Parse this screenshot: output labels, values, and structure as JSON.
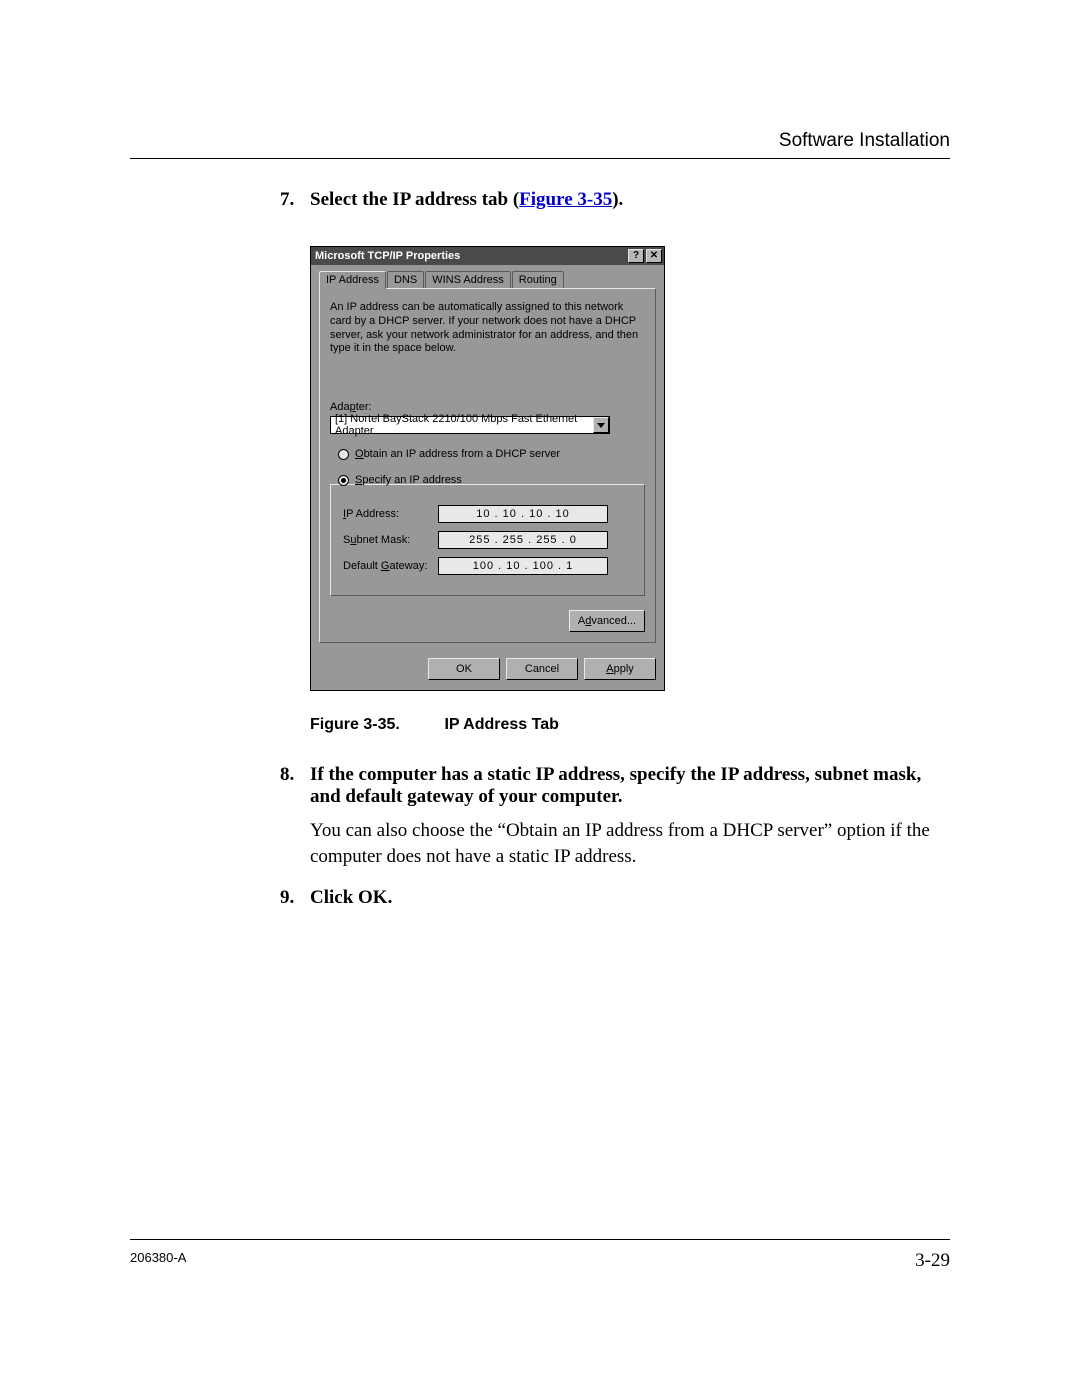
{
  "header": {
    "title": "Software Installation"
  },
  "steps": {
    "s7": {
      "num": "7.",
      "prefix": "Select the IP address tab (",
      "link": "Figure 3-35",
      "suffix": ")."
    },
    "s8": {
      "num": "8.",
      "bold": "If the computer has a static IP address, specify the IP address, subnet mask, and default gateway of your computer.",
      "body": "You can also choose the “Obtain an IP address from a DHCP server” option if the computer does not have a static IP address."
    },
    "s9": {
      "num": "9.",
      "bold": "Click OK."
    }
  },
  "figure": {
    "label": "Figure 3-35.",
    "caption": "IP Address Tab"
  },
  "dialog": {
    "title": "Microsoft TCP/IP Properties",
    "help": "?",
    "close": "✕",
    "tabs": {
      "ip": "IP Address",
      "dns": "DNS",
      "wins": "WINS Address",
      "routing": "Routing"
    },
    "desc": "An IP address can be automatically assigned to this network card by a DHCP server. If your network does not have a DHCP server, ask your network administrator for an address, and then type it in the space below.",
    "adapter_label_pre": "Ada",
    "adapter_label_u": "p",
    "adapter_label_post": "ter:",
    "adapter_value": "[1] Nortel BayStack 2210/100 Mbps Fast Ethernet Adapter",
    "radio_obtain_u": "O",
    "radio_obtain_post": "btain an IP address from a DHCP server",
    "radio_specify_u": "S",
    "radio_specify_post": "pecify an IP address",
    "ip_label_u": "I",
    "ip_label_post": "P Address:",
    "ip_value": "10 . 10 . 10 . 10",
    "subnet_label_pre": "S",
    "subnet_label_u": "u",
    "subnet_label_post": "bnet Mask:",
    "subnet_value": "255 . 255 . 255 . 0",
    "gateway_label_pre": "Default ",
    "gateway_label_u": "G",
    "gateway_label_post": "ateway:",
    "gateway_value": "100 . 10 . 100 . 1",
    "advanced_pre": "A",
    "advanced_u": "d",
    "advanced_post": "vanced...",
    "ok": "OK",
    "cancel": "Cancel",
    "apply_u": "A",
    "apply_post": "pply"
  },
  "footer": {
    "doc_id": "206380-A",
    "page": "3-29"
  }
}
